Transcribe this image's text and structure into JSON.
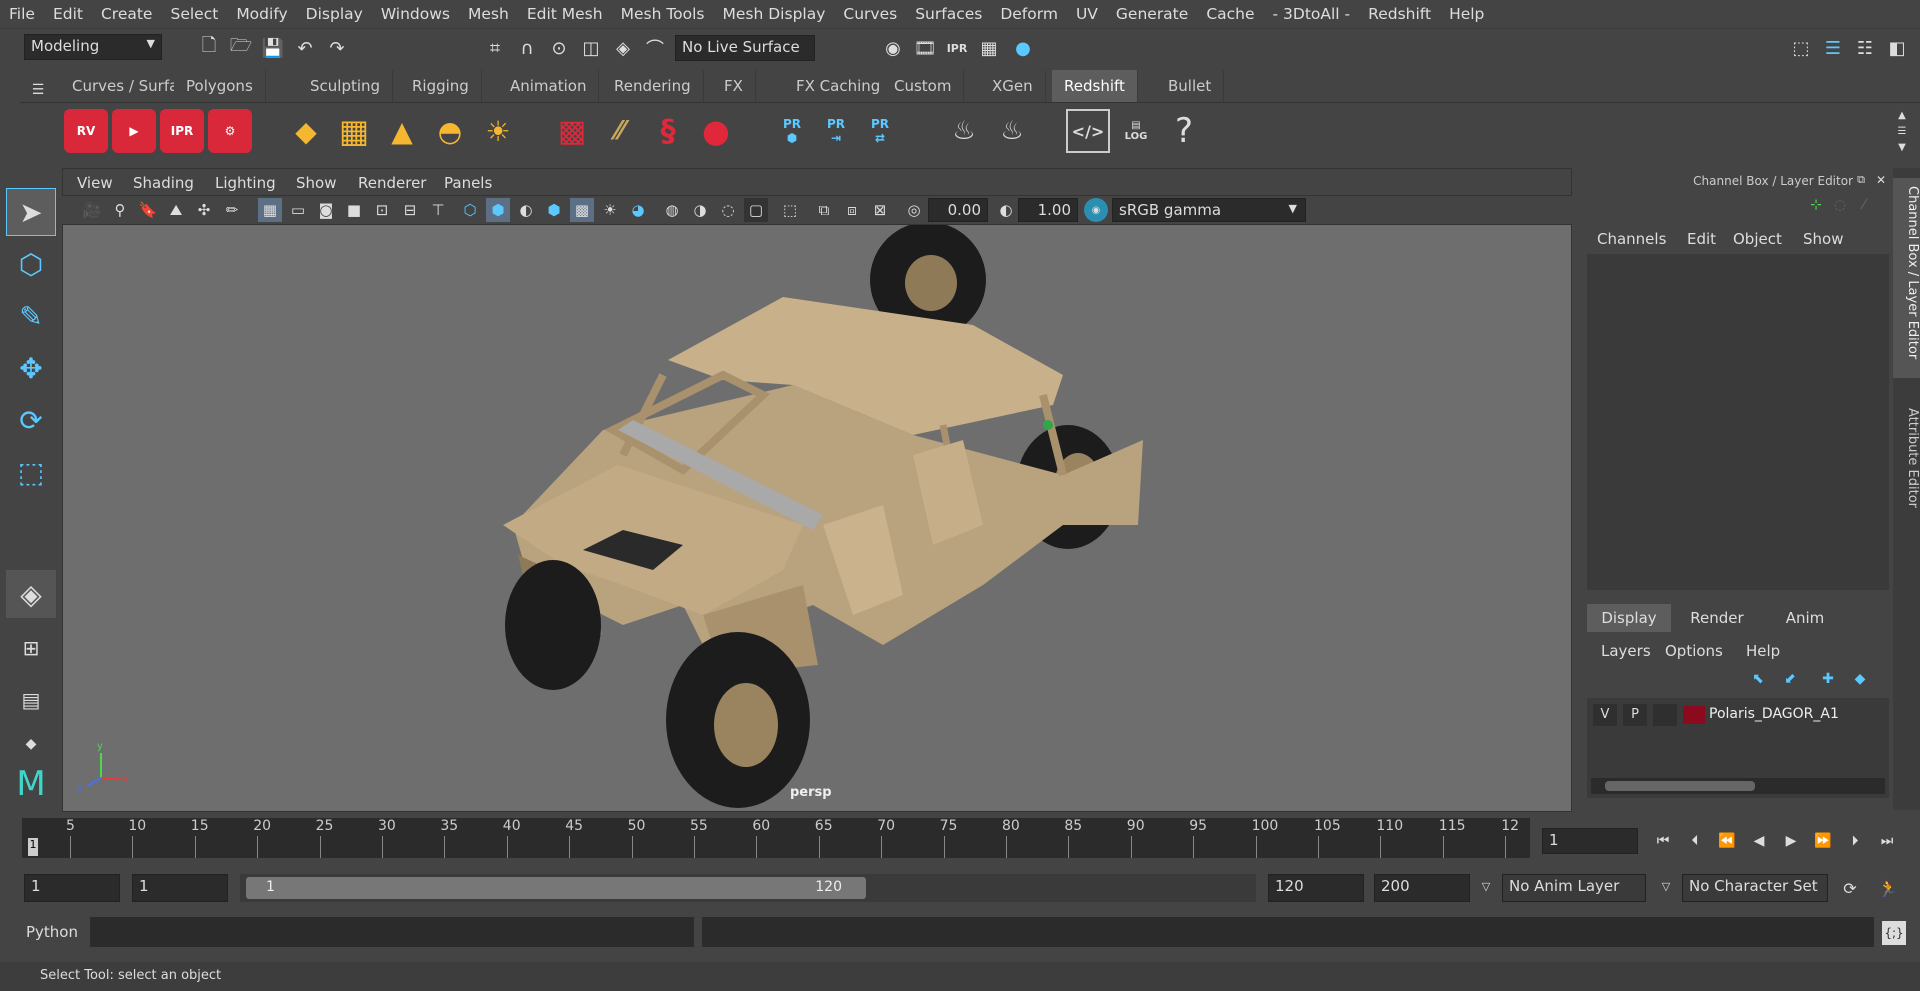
{
  "menubar": {
    "items": [
      "File",
      "Edit",
      "Create",
      "Select",
      "Modify",
      "Display",
      "Windows",
      "Mesh",
      "Edit Mesh",
      "Mesh Tools",
      "Mesh Display",
      "Curves",
      "Surfaces",
      "Deform",
      "UV",
      "Generate",
      "Cache",
      "- 3DtoAll -",
      "Redshift",
      "Help"
    ]
  },
  "status": {
    "mode": "Modeling",
    "live_surface": "No Live Surface"
  },
  "shelf": {
    "tabs": [
      "Curves / Surfaces",
      "Polygons",
      "Sculpting",
      "Rigging",
      "Animation",
      "Rendering",
      "FX",
      "FX Caching",
      "Custom",
      "XGen",
      "Redshift",
      "Bullet"
    ],
    "active_tab": "Redshift",
    "rv_label": "RV",
    "ipr_label": "IPR",
    "pr_label": "PR",
    "log_label": "LOG",
    "help_glyph": "?"
  },
  "viewport": {
    "menu": [
      "View",
      "Shading",
      "Lighting",
      "Show",
      "Renderer",
      "Panels"
    ],
    "exposure": "0.00",
    "gamma": "1.00",
    "color_space": "sRGB gamma",
    "camera_label": "persp",
    "axis": {
      "x": "x",
      "y": "y",
      "z": "z"
    }
  },
  "channel_box": {
    "title": "Channel Box / Layer Editor",
    "menu": [
      "Channels",
      "Edit",
      "Object",
      "Show"
    ],
    "layer_tabs": [
      "Display",
      "Render",
      "Anim"
    ],
    "active_layer_tab": "Display",
    "layer_menu": [
      "Layers",
      "Options",
      "Help"
    ],
    "layers": [
      {
        "v": "V",
        "p": "P",
        "color": "#8b0a1e",
        "name": "Polaris_DAGOR_A1"
      }
    ]
  },
  "side_tabs": [
    "Channel Box / Layer Editor",
    "Attribute Editor"
  ],
  "timeline": {
    "ticks": [
      "5",
      "10",
      "15",
      "20",
      "25",
      "30",
      "35",
      "40",
      "45",
      "50",
      "55",
      "60",
      "65",
      "70",
      "75",
      "80",
      "85",
      "90",
      "95",
      "100",
      "105",
      "110",
      "115",
      "12"
    ],
    "current_frame_marker": "1",
    "current_frame": "1"
  },
  "range": {
    "start": "1",
    "playback_start": "1",
    "slider_start": "1",
    "slider_end": "120",
    "playback_end": "120",
    "end": "200",
    "anim_layer": "No Anim Layer",
    "character_set": "No Character Set"
  },
  "cmdline": {
    "label": "Python"
  },
  "helpline": {
    "text": "Select Tool: select an object"
  },
  "colors": {
    "accent_blue": "#5bc8ff",
    "redshift_red": "#e0283a",
    "layer_color": "#8b0a1e"
  }
}
